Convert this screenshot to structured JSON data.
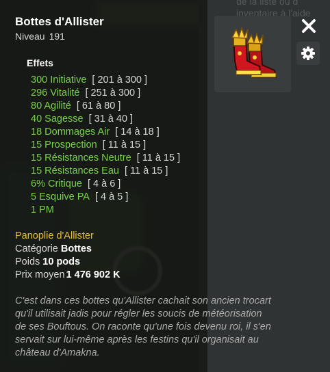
{
  "item": {
    "name": "Bottes d'Allister",
    "level_label": "Niveau",
    "level": "191"
  },
  "effects": {
    "title": "Effets",
    "lines": [
      {
        "value": "300 Initiative",
        "range": "[ 201 à 300 ]"
      },
      {
        "value": "296 Vitalité",
        "range": "[ 251 à 300 ]"
      },
      {
        "value": "80 Agilité",
        "range": "[ 61 à 80 ]"
      },
      {
        "value": "40 Sagesse",
        "range": "[ 31 à 40 ]"
      },
      {
        "value": "18 Dommages Air",
        "range": "[ 14 à 18 ]"
      },
      {
        "value": "15 Prospection",
        "range": "[ 11 à 15 ]"
      },
      {
        "value": "15 Résistances Neutre",
        "range": "[ 11 à 15 ]"
      },
      {
        "value": "15 Résistances Eau",
        "range": "[ 11 à 15 ]"
      },
      {
        "value": "6% Critique",
        "range": "[ 4 à 6 ]"
      },
      {
        "value": "5 Esquive PA",
        "range": "[ 4 à 5 ]"
      },
      {
        "value": "1 PM",
        "range": ""
      }
    ]
  },
  "set": {
    "name": "Panoplie d'Allister"
  },
  "details": {
    "category_label": "Catégorie",
    "category": "Bottes",
    "weight_label": "Poids",
    "weight": "10 pods",
    "price_label": "Prix moyen",
    "price": "1 476 902 K"
  },
  "description": "C'est dans ces bottes qu'Allister cachait son ancien trocart qu'il utilisait jadis pour régler les soucis de météorisation de ses Bouftous. On raconte qu'une fois devenu roi, il s'en servait sur lui-même après les festins qu'il organisait au château d'Amakna.",
  "background_text": "de la liste ou d inventaire à l'aide",
  "icons": {
    "item": "boots-item-icon",
    "close": "close-icon",
    "settings": "gear-icon"
  },
  "colors": {
    "effect": "#78d24a",
    "set": "#e8c02a",
    "panel": "#161815"
  }
}
